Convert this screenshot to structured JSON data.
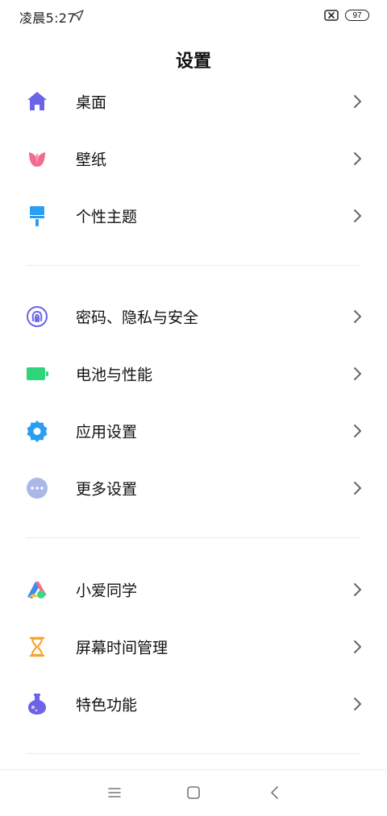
{
  "status_bar": {
    "time": "凌晨5:27",
    "battery_level": "97",
    "icons": [
      "location-arrow-icon",
      "no-sim-icon",
      "battery-icon"
    ]
  },
  "page": {
    "title": "设置"
  },
  "groups": [
    {
      "items": [
        {
          "label": "桌面",
          "icon": "home-icon",
          "color": "#6b63e8"
        },
        {
          "label": "壁纸",
          "icon": "tulip-icon",
          "color": "#f06b8f"
        },
        {
          "label": "个性主题",
          "icon": "paintbrush-icon",
          "color": "#2a9df4"
        }
      ]
    },
    {
      "items": [
        {
          "label": "密码、隐私与安全",
          "icon": "fingerprint-icon",
          "color": "#6b63e8"
        },
        {
          "label": "电池与性能",
          "icon": "battery-green-icon",
          "color": "#2fd57d"
        },
        {
          "label": "应用设置",
          "icon": "gear-icon",
          "color": "#2a9df4"
        },
        {
          "label": "更多设置",
          "icon": "more-dots-icon",
          "color": "#a9b8e6"
        }
      ]
    },
    {
      "items": [
        {
          "label": "小爱同学",
          "icon": "xiaoai-icon",
          "color": "#ff6b8a"
        },
        {
          "label": "屏幕时间管理",
          "icon": "hourglass-icon",
          "color": "#f7a531"
        },
        {
          "label": "特色功能",
          "icon": "flask-icon",
          "color": "#6b63e8"
        }
      ]
    }
  ],
  "nav_bar": {
    "buttons": [
      "menu-icon",
      "home-square-icon",
      "back-icon"
    ]
  }
}
